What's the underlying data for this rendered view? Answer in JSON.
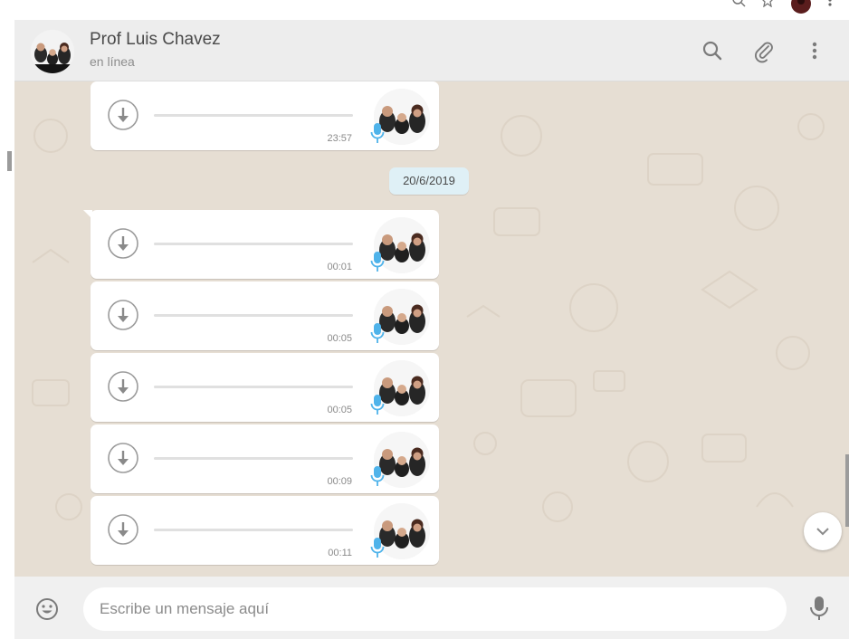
{
  "header": {
    "contact_name": "Prof Luis Chavez",
    "contact_status": "en línea",
    "icons": [
      "search-icon",
      "attach-icon",
      "more-vert-icon"
    ]
  },
  "chat": {
    "date_separator": "20/6/2019",
    "voice_messages": [
      {
        "duration": "23:57"
      },
      {
        "duration": "00:01"
      },
      {
        "duration": "00:05"
      },
      {
        "duration": "00:05"
      },
      {
        "duration": "00:09"
      },
      {
        "duration": "00:11"
      }
    ]
  },
  "footer": {
    "placeholder": "Escribe un mensaje aquí",
    "icons": [
      "emoji-icon",
      "microphone-icon"
    ]
  },
  "colors": {
    "chat_background": "#e6ded3",
    "bubble": "#ffffff",
    "date_chip": "#dff0f6",
    "mic_accent": "#4fb3ea",
    "header": "#ededed"
  }
}
